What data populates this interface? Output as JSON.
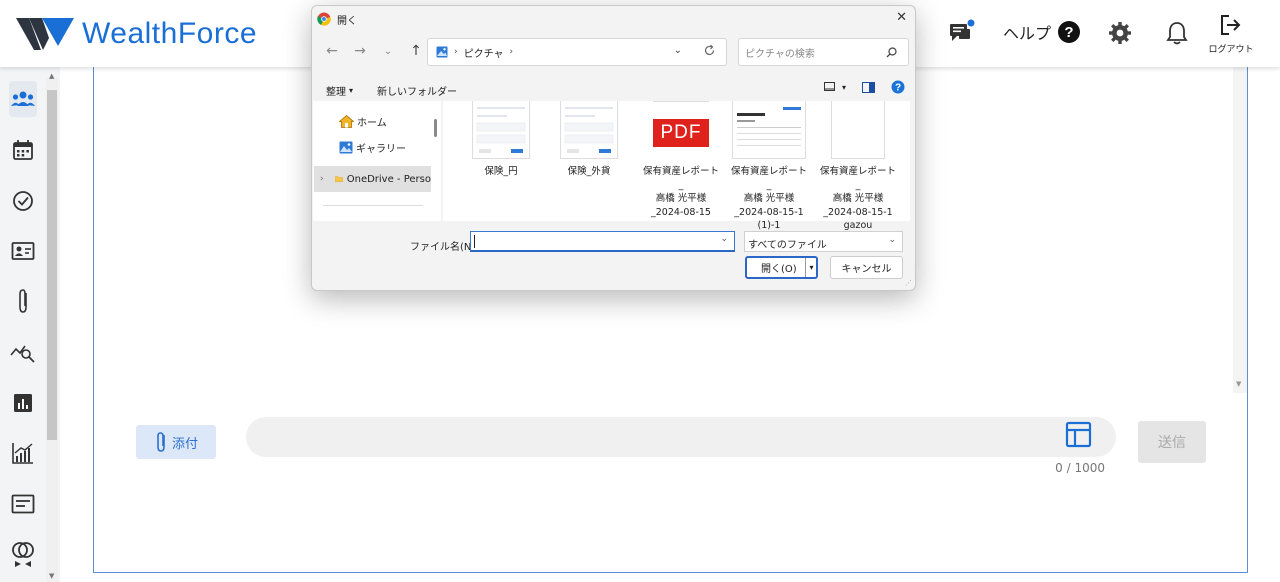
{
  "app": {
    "brand": "WealthForce",
    "brand_color": "#1a6fd6"
  },
  "header": {
    "help_label": "ヘルプ",
    "help_symbol": "?",
    "logout_label": "ログアウト"
  },
  "sidebar": {
    "items": [
      {
        "icon": "users-icon"
      },
      {
        "icon": "calendar-icon"
      },
      {
        "icon": "check-circle-icon"
      },
      {
        "icon": "contact-card-icon"
      },
      {
        "icon": "paperclip-icon"
      },
      {
        "icon": "trend-search-icon"
      },
      {
        "icon": "bar-chart-icon"
      },
      {
        "icon": "growth-chart-icon"
      },
      {
        "icon": "document-icon"
      },
      {
        "icon": "rings-icon"
      }
    ]
  },
  "composer": {
    "attach_label": "添付",
    "input_value": "",
    "counter": "0 / 1000",
    "send_label": "送信"
  },
  "dialog": {
    "title": "開く",
    "close_symbol": "✕",
    "nav": {
      "back": "←",
      "forward": "→",
      "recent": "⌄",
      "up": "↑"
    },
    "address": {
      "folder": "ピクチャ",
      "sep1": "›",
      "sep2": "›"
    },
    "search_placeholder": "ピクチャの検索",
    "toolbar": {
      "organize": "整理",
      "new_folder": "新しいフォルダー",
      "help_symbol": "?"
    },
    "left_nav": [
      {
        "label": "ホーム",
        "icon": "home-icon"
      },
      {
        "label": "ギャラリー",
        "icon": "gallery-icon"
      },
      {
        "label": "OneDrive - Perso",
        "icon": "folder-icon",
        "expander": "›"
      }
    ],
    "files": [
      {
        "name_lines": [
          "保険_円"
        ],
        "type": "screenshot"
      },
      {
        "name_lines": [
          "保険_外貨"
        ],
        "type": "screenshot"
      },
      {
        "name_lines": [
          "保有資産レポート_",
          "高橋 光平様",
          "_2024-08-15"
        ],
        "type": "pdf",
        "badge": "PDF"
      },
      {
        "name_lines": [
          "保有資産レポート_",
          "高橋 光平様",
          "_2024-08-15-1",
          "(1)-1"
        ],
        "type": "report-image"
      },
      {
        "name_lines": [
          "保有資産レポート_",
          "高橋 光平様",
          "_2024-08-15-1",
          "gazou"
        ],
        "type": "blank-file"
      }
    ],
    "filename_label": "ファイル名(N):",
    "filename_value": "",
    "filter_value": "すべてのファイル",
    "open_label": "開く(O)",
    "cancel_label": "キャンセル"
  }
}
